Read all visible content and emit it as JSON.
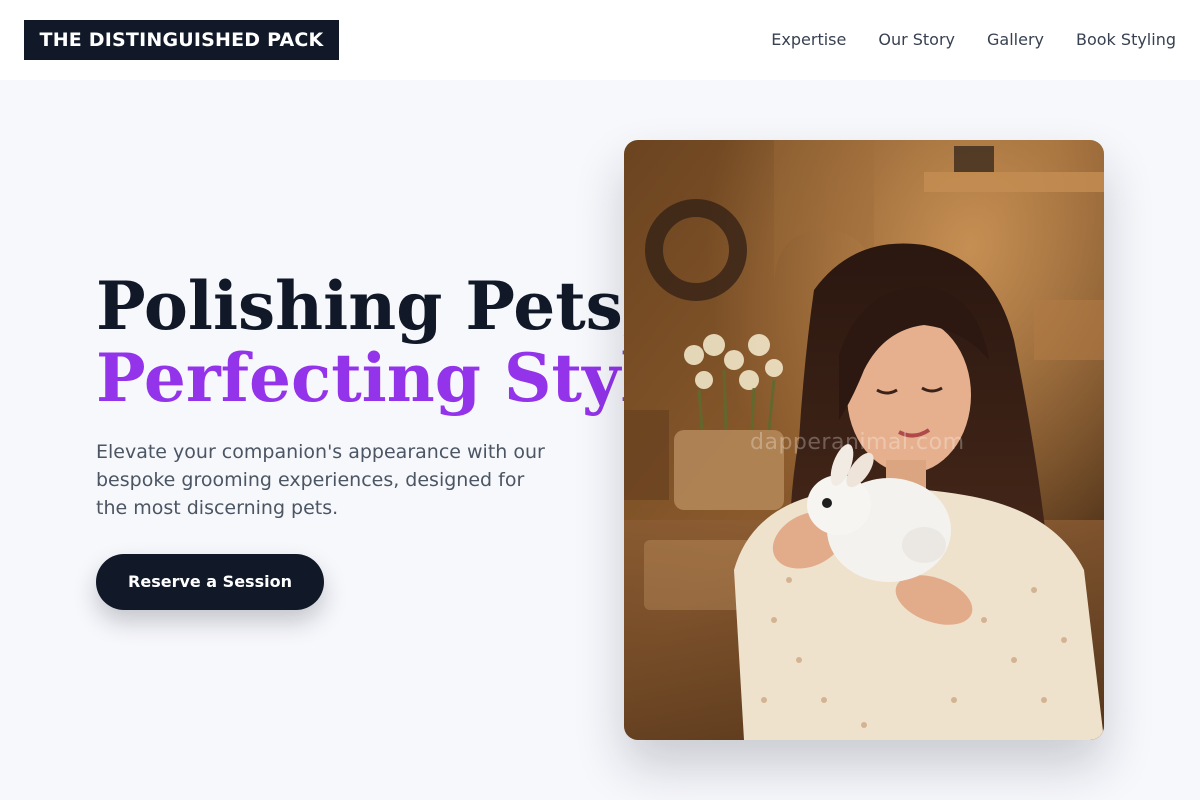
{
  "brand": {
    "name": "THE DISTINGUISHED PACK"
  },
  "nav": {
    "items": [
      {
        "label": "Expertise"
      },
      {
        "label": "Our Story"
      },
      {
        "label": "Gallery"
      },
      {
        "label": "Book Styling"
      }
    ]
  },
  "hero": {
    "title_line1": "Polishing Pets,",
    "title_line2": "Perfecting Style.",
    "subtitle": "Elevate your companion's appearance with our bespoke grooming experiences, designed for the most discerning pets.",
    "cta_label": "Reserve a Session",
    "image": {
      "watermark": "dapperanimal.com"
    }
  },
  "colors": {
    "accent": "#9333ea",
    "dark": "#111827",
    "background": "#f7f8fc"
  }
}
